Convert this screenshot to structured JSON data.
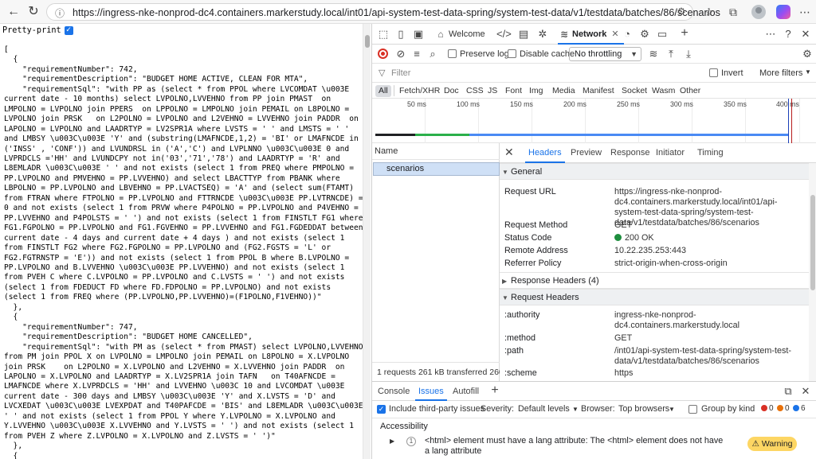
{
  "browser": {
    "url": "https://ingress-nke-nonprod-dc4.containers.markerstudy.local/int01/api-system-test-data-spring/system-test-data/v1/testdata/batches/86/scenarios"
  },
  "page": {
    "pretty_print_label": "Pretty-print",
    "json_text": "[\n  {\n    \"requirementNumber\": 742,\n    \"requirementDescription\": \"BUDGET HOME ACTIVE, CLEAN FOR MTA\",\n    \"requirementSql\": \"with PP as (select * from PPOL where LVCOMDAT \\u003E\ncurrent date - 10 months) select LVPOLNO,LVVEHNO from PP join PMAST  on\nLMPOLNO = LVPOLNO join PPERS  on LPPOLNO = LMPOLNO join PEMAIL on L8POLNO =\nLVPOLNO join PRSK   on L2POLNO = LVPOLNO and L2VEHNO = LVVEHNO join PADDR  on\nLAPOLNO = LVPOLNO and LAADRTYP = LV2SPR1A where LVSTS = ' ' and LMSTS = ' '\nand LMBSY \\u003C\\u003E 'Y' and (substring(LMAFNCDE,1,2) = 'BI' or LMAFNCDE in\n('INSS' , 'CONF')) and LVUNDRSL in ('A','C') and LVPLNNO \\u003C\\u003E 0 and\nLVPRDCLS ='HH' and LVUNDCPY not in('03','71','78') and LAADRTYP = 'R' and\nL8EMLADR \\u003C\\u003E ' ' and not exists (select 1 from PREQ where PMPOLNO =\nPP.LVPOLNO and PMVEHNO = PP.LVVEHNO) and select LBACTTYP from PBANK where\nLBPOLNO = PP.LVPOLNO and LBVEHNO = PP.LVACTSEQ) = 'A' and (select sum(FTAMT)\nfrom FTRAN where FTPOLNO = PP.LVPOLNO and FTTRNCDE \\u003C\\u003E PP.LVTRNCDE) =\n0 and not exists (select 1 from PRVW where P4POLNO = PP.LVPOLNO and P4VEHNO =\nPP.LVVEHNO and P4POLSTS = ' ') and not exists (select 1 from FINSTLT FG1 where\nFG1.FGPOLNO = PP.LVPOLNO and FG1.FGVEHNO = PP.LVVEHNO and FG1.FGDEDDAT between\ncurrent date - 4 days and current date + 4 days ) and not exists (select 1\nfrom FINSTLT FG2 where FG2.FGPOLNO = PP.LVPOLNO and (FG2.FGSTS = 'L' or\nFG2.FGTRNSTP = 'E')) and not exists (select 1 from PPOL B where B.LVPOLNO =\nPP.LVPOLNO and B.LVVEHNO \\u003C\\u003E PP.LVVEHNO) and not exists (select 1\nfrom PVEH C where C.LVPOLNO = PP.LVPOLNO and C.LVSTS = ' ') and not exists\n(select 1 from FDEDUCT FD where FD.FDPOLNO = PP.LVPOLNO) and not exists\n(select 1 from FREQ where (PP.LVPOLNO,PP.LVVEHNO)=(F1POLNO,F1VEHNO))\"\n  },\n  {\n    \"requirementNumber\": 747,\n    \"requirementDescription\": \"BUDGET HOME CANCELLED\",\n    \"requirementSql\": \"with PM as (select * from PMAST) select LVPOLNO,LVVEHNO\nfrom PM join PPOL X on LVPOLNO = LMPOLNO join PEMAIL on L8POLNO = X.LVPOLNO\njoin PRSK    on L2POLNO = X.LVPOLNO and L2VEHNO = X.LVVEHNO join PADDR  on\nLAPOLNO = X.LVPOLNO and LAADRTYP = X.LV2SPR1A join TAFN   on T40AFNCDE =\nLMAFNCDE where X.LVPRDCLS = 'HH' and LVVEHNO \\u003C 10 and LVCOMDAT \\u003E\ncurrent date - 300 days and LMBSY \\u003C\\u003E 'Y' and X.LVSTS = 'D' and\nLVCXEDAT \\u003C\\u003E LVEXPDAT and T40PAFCDE = 'BIS' and L8EMLADR \\u003C\\u003E\n' ' and not exists (select 1 from PPOL Y where Y.LVPOLNO = X.LVPOLNO and\nY.LVVEHNO \\u003C\\u003E X.LVVEHNO and Y.LVSTS = ' ') and not exists (select 1\nfrom PVEH Z where Z.LVPOLNO = X.LVPOLNO and Z.LVSTS = ' ')\"\n  },\n  {"
  },
  "devtools": {
    "tabs": [
      {
        "label": "Welcome"
      },
      {
        "label": "Network"
      }
    ],
    "preserve_log": "Preserve log",
    "disable_cache": "Disable cache",
    "throttling": "No throttling",
    "filter_placeholder": "Filter",
    "invert": "Invert",
    "more_filters": "More filters",
    "type_filters": [
      "All",
      "Fetch/XHR",
      "Doc",
      "CSS",
      "JS",
      "Font",
      "Img",
      "Media",
      "Manifest",
      "Socket",
      "Wasm",
      "Other"
    ],
    "timeline_labels": [
      "50 ms",
      "100 ms",
      "150 ms",
      "200 ms",
      "250 ms",
      "300 ms",
      "350 ms",
      "400 ms"
    ],
    "name_header": "Name",
    "request_name": "scenarios",
    "status_bar": "1 requests  261 kB transferred  260",
    "detail_tabs": [
      "Headers",
      "Preview",
      "Response",
      "Initiator",
      "Timing"
    ],
    "general": {
      "title": "General",
      "rows": [
        {
          "key": "Request URL",
          "value": "https://ingress-nke-nonprod-dc4.containers.markerstudy.local/int01/api-system-test-data-spring/system-test-data/v1/testdata/batches/86/scenarios"
        },
        {
          "key": "Request Method",
          "value": "GET"
        },
        {
          "key": "Status Code",
          "value": "200 OK"
        },
        {
          "key": "Remote Address",
          "value": "10.22.235.253:443"
        },
        {
          "key": "Referrer Policy",
          "value": "strict-origin-when-cross-origin"
        }
      ]
    },
    "response_headers": "Response Headers (4)",
    "request_headers": {
      "title": "Request Headers",
      "rows": [
        {
          "key": ":authority",
          "value": "ingress-nke-nonprod-dc4.containers.markerstudy.local"
        },
        {
          "key": ":method",
          "value": "GET"
        },
        {
          "key": ":path",
          "value": "/int01/api-system-test-data-spring/system-test-data/v1/testdata/batches/86/scenarios"
        },
        {
          "key": ":scheme",
          "value": "https"
        }
      ]
    },
    "drawer": {
      "tabs": [
        "Console",
        "Issues",
        "Autofill"
      ],
      "include_third_party": "Include third-party issues",
      "severity_label": "Severity:",
      "severity_value": "Default levels",
      "browser_label": "Browser:",
      "browser_value": "Top browsers",
      "group_by_kind": "Group by kind",
      "counts": [
        "0",
        "0",
        "6"
      ],
      "accessibility": "Accessibility",
      "issue_count": "1",
      "issue_text": "<html> element must have a lang attribute: The <html> element does not have a lang attribute",
      "warning": "Warning",
      "colors": {
        "error": "#d93025",
        "info": "#1a73e8",
        "warning_bg": "#fdd663"
      }
    }
  }
}
